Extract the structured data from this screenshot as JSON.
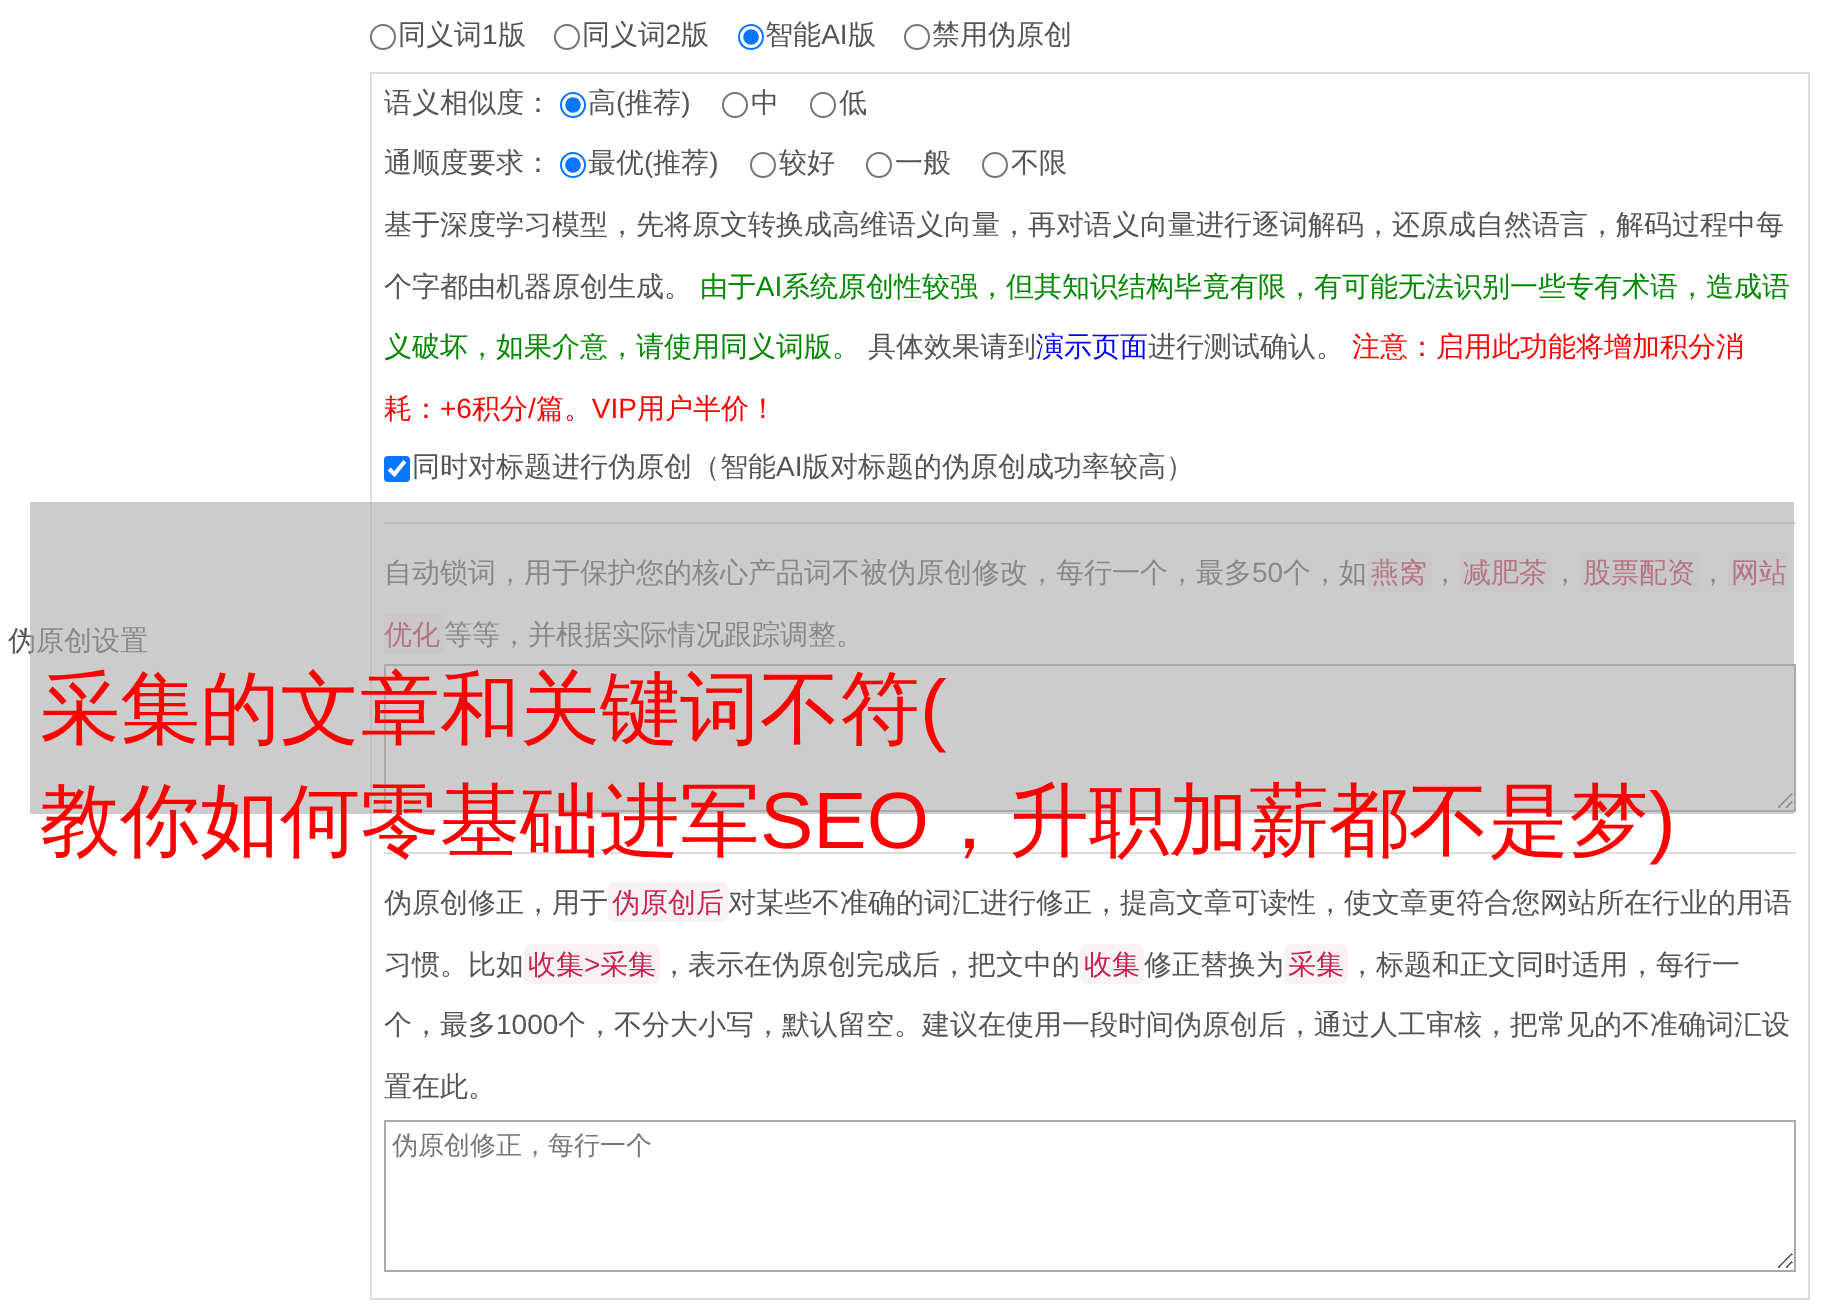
{
  "sidebar_label": "伪原创设置",
  "modes": [
    {
      "label": "同义词1版",
      "selected": false
    },
    {
      "label": "同义词2版",
      "selected": false
    },
    {
      "label": "智能AI版",
      "selected": true
    },
    {
      "label": "禁用伪原创",
      "selected": false
    }
  ],
  "settings": [
    {
      "label": "语义相似度：",
      "options": [
        {
          "label": "高(推荐)",
          "selected": true
        },
        {
          "label": "中",
          "selected": false
        },
        {
          "label": "低",
          "selected": false
        }
      ]
    },
    {
      "label": "通顺度要求：",
      "options": [
        {
          "label": "最优(推荐)",
          "selected": true
        },
        {
          "label": "较好",
          "selected": false
        },
        {
          "label": "一般",
          "selected": false
        },
        {
          "label": "不限",
          "selected": false
        }
      ]
    }
  ],
  "description": [
    {
      "kind": "text",
      "text": "基于深度学习模型，先将原文转换成高维语义向量，再对语义向量进行逐词解码，还原成自然语言，解码过程中每个字都由机器原创生成。 "
    },
    {
      "kind": "green",
      "text": "由于AI系统原创性较强，但其知识结构毕竟有限，有可能无法识别一些专有术语，造成语义破坏，如果介意，请使用同义词版。"
    },
    {
      "kind": "text",
      "text": " 具体效果请到"
    },
    {
      "kind": "link",
      "text": "演示页面"
    },
    {
      "kind": "text",
      "text": "进行测试确认。 "
    },
    {
      "kind": "red",
      "text": "注意：启用此功能将增加积分消耗：+6积分/篇。VIP用户半价！"
    }
  ],
  "title_option": {
    "label": "同时对标题进行伪原创（智能AI版对标题的伪原创成功率较高）",
    "checked": true
  },
  "lock_words": {
    "parts": [
      {
        "kind": "text",
        "text": "自动锁词，用于保护您的核心产品词不被伪原创修改，每行一个，最多50个，如"
      },
      {
        "kind": "tag",
        "text": "燕窝"
      },
      {
        "kind": "text",
        "text": "，"
      },
      {
        "kind": "tag",
        "text": "减肥茶"
      },
      {
        "kind": "text",
        "text": "，"
      },
      {
        "kind": "tag",
        "text": "股票配资"
      },
      {
        "kind": "text",
        "text": "，"
      },
      {
        "kind": "tag",
        "text": "网站优化"
      },
      {
        "kind": "text",
        "text": "等等，并根据实际情况跟踪调整。"
      }
    ]
  },
  "correction": {
    "parts": [
      {
        "kind": "text",
        "text": "伪原创修正，用于"
      },
      {
        "kind": "tag",
        "text": "伪原创后"
      },
      {
        "kind": "text",
        "text": "对某些不准确的词汇进行修正，提高文章可读性，使文章更符合您网站所在行业的用语习惯。比如"
      },
      {
        "kind": "tag",
        "text": "收集>采集"
      },
      {
        "kind": "text",
        "text": "，表示在伪原创完成后，把文中的"
      },
      {
        "kind": "tag",
        "text": "收集"
      },
      {
        "kind": "text",
        "text": "修正替换为"
      },
      {
        "kind": "tag",
        "text": "采集"
      },
      {
        "kind": "text",
        "text": "，标题和正文同时适用，每行一个，最多1000个，不分大小写，默认留空。建议在使用一段时间伪原创后，通过人工审核，把常见的不准确词汇设置在此。"
      }
    ],
    "placeholder": "伪原创修正，每行一个"
  },
  "overlay_title": [
    "采集的文章和关键词不符(",
    "教你如何零基础进军SEO，升职加薪都不是梦)"
  ]
}
